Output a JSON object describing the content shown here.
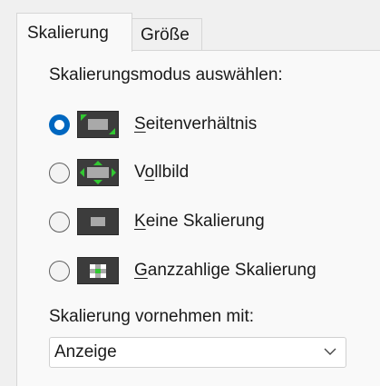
{
  "tabs": [
    {
      "label": "Skalierung",
      "active": true
    },
    {
      "label": "Größe",
      "active": false
    }
  ],
  "mode_heading": "Skalierungsmodus auswählen:",
  "options": [
    {
      "mnemonic": "S",
      "rest": "eitenverhältnis",
      "icon": "aspect-ratio-icon",
      "selected": true
    },
    {
      "pre": "V",
      "mnemonic": "o",
      "rest": "llbild",
      "icon": "fullscreen-icon",
      "selected": false
    },
    {
      "mnemonic": "K",
      "rest": "eine Skalierung",
      "icon": "no-scaling-icon",
      "selected": false
    },
    {
      "mnemonic": "G",
      "rest": "anzzahlige Skalierung",
      "icon": "integer-scaling-icon",
      "selected": false
    }
  ],
  "perform_label": "Skalierung vornehmen mit:",
  "perform_select": {
    "value": "Anzeige"
  },
  "colors": {
    "accent": "#0067c0",
    "thumb_bg": "#3c3c3c",
    "thumb_screen": "#a9a9a9",
    "arrow_green": "#32c832"
  }
}
